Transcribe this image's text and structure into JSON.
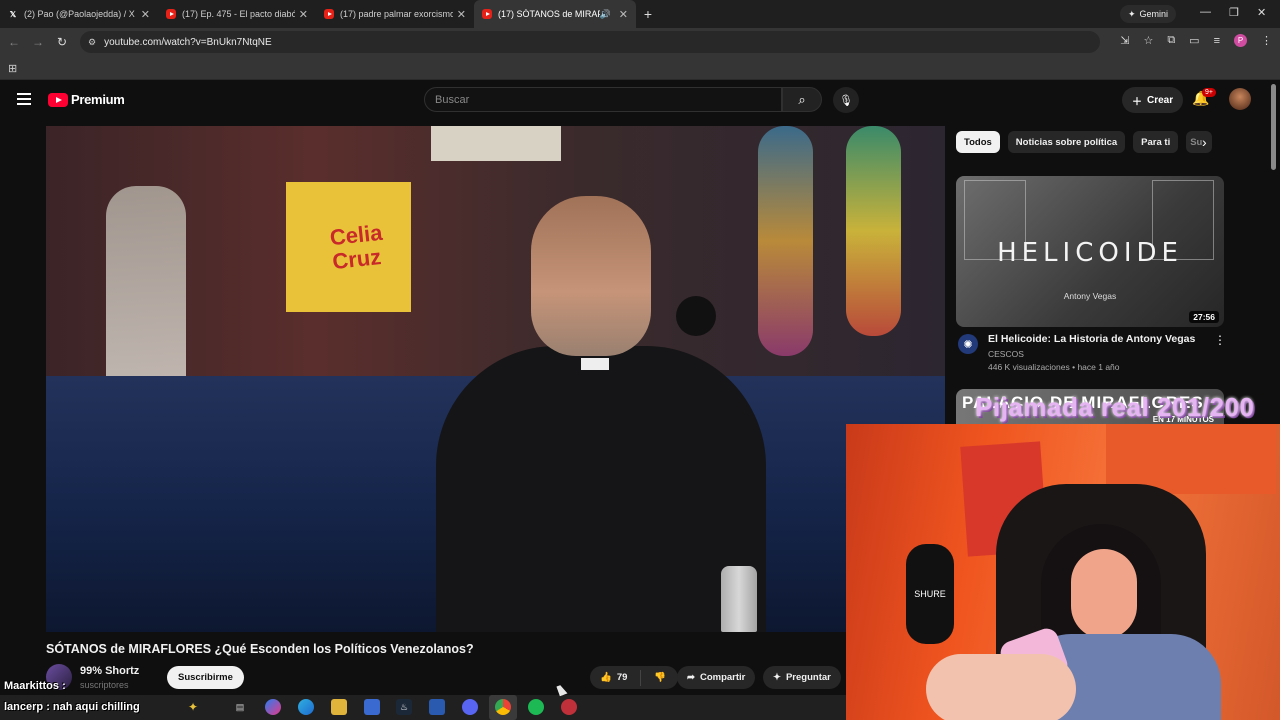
{
  "browser": {
    "tabs": [
      {
        "label": "(2) Pao (@Paolaojedda) / X",
        "icon": "x-logo-icon"
      },
      {
        "label": "(17) Ep. 475 - El pacto diabólico",
        "icon": "youtube-icon"
      },
      {
        "label": "(17) padre palmar exorcismo c",
        "icon": "youtube-icon"
      },
      {
        "label": "(17) SÓTANOS de MIRAFLO",
        "icon": "youtube-icon",
        "active": true
      }
    ],
    "gemini_label": "Gemini",
    "url": "youtube.com/watch?v=BnUkn7NtqNE"
  },
  "masthead": {
    "logo_word": "Premium",
    "search_placeholder": "Buscar",
    "create_label": "Crear",
    "notif_count": "9+"
  },
  "video": {
    "poster_text": "Celia Cruz",
    "title": "SÓTANOS de MIRAFLORES ¿Qué Esconden los Políticos Venezolanos?",
    "channel": "99% Shortz",
    "subscribers": "suscriptores",
    "subscribe_label": "Suscribirme",
    "likes": "79",
    "share_label": "Compartir",
    "ask_label": "Preguntar"
  },
  "sidebar": {
    "chips": [
      "Todos",
      "Noticias sobre política",
      "Para ti",
      "Su"
    ],
    "rec1": {
      "thumb_title": "HELICOIDE",
      "thumb_sub": "Antony Vegas",
      "duration": "27:56",
      "title": "El Helicoide: La Historia de Antony Vegas",
      "channel": "CESCOS",
      "meta": "446 K visualizaciones • hace 1 año"
    },
    "rec2": {
      "thumb_title": "PALACIO DE MIRAFLORES",
      "thumb_sub": "EN 17 MINUTOS"
    }
  },
  "stream": {
    "overlay_title": "Pijamada real 201/200",
    "mic_brand": "SHURE",
    "chat": [
      {
        "user": "Maarkittos",
        "text": ""
      },
      {
        "user": "lancerp",
        "text": "nah aqui chilling"
      }
    ]
  },
  "colors": {
    "background": "#0f0f0f",
    "youtube_red": "#ff0033",
    "overlay_text": "#e6b4f2"
  }
}
